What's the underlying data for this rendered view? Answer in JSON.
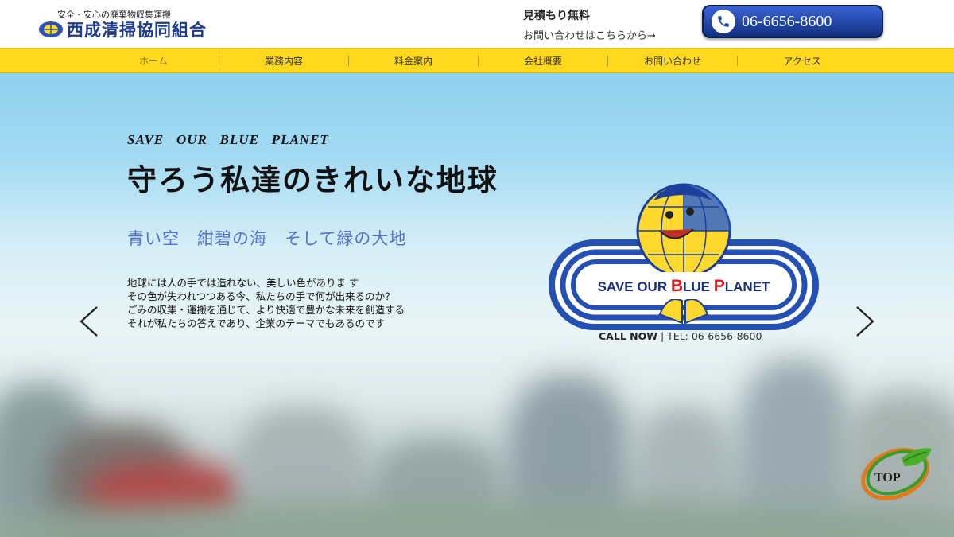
{
  "header": {
    "tagline": "安全・安心の廃棄物収集運搬",
    "company_name": "西成清掃協同組合",
    "estimate_free": "見積もり無料",
    "contact_link": "お問い合わせはこちらから→",
    "phone": "06-6656-8600"
  },
  "nav": {
    "items": [
      {
        "label": "ホーム",
        "active": true
      },
      {
        "label": "業務内容"
      },
      {
        "label": "料金案内"
      },
      {
        "label": "会社概要"
      },
      {
        "label": "お問い合わせ"
      },
      {
        "label": "アクセス"
      }
    ]
  },
  "hero": {
    "slogan_en": "SAVE   OUR   BLUE   PLANET",
    "slogan_jp": "守ろう私達のきれいな地球",
    "sub_jp": "青い空　紺碧の海　そして緑の大地",
    "body_lines": [
      "地球には人の手では造れない、美しい色がありま す",
      "その色が失われつつある今、私たちの手で何が出来るのか？",
      "ごみの収集・運搬を通じて、より快適で豊かな未来を創造する",
      "それが私たちの答えであり、企業のテーマでもあるのです"
    ],
    "emblem_text_pre": "SAVE OUR ",
    "emblem_b": "B",
    "emblem_lue": "LUE ",
    "emblem_p": "P",
    "emblem_lanet": "LANET",
    "callnow_label": "CALL NOW",
    "callnow_tel": " | TEL: 06-6656-8600"
  },
  "top_button": "TOP",
  "colors": {
    "nav_bg": "#ffd91e",
    "company_blue": "#1e3c8c",
    "sub_blue": "#5570c8",
    "phone_btn": "#2a4fbf",
    "emblem_red": "#e02020"
  }
}
